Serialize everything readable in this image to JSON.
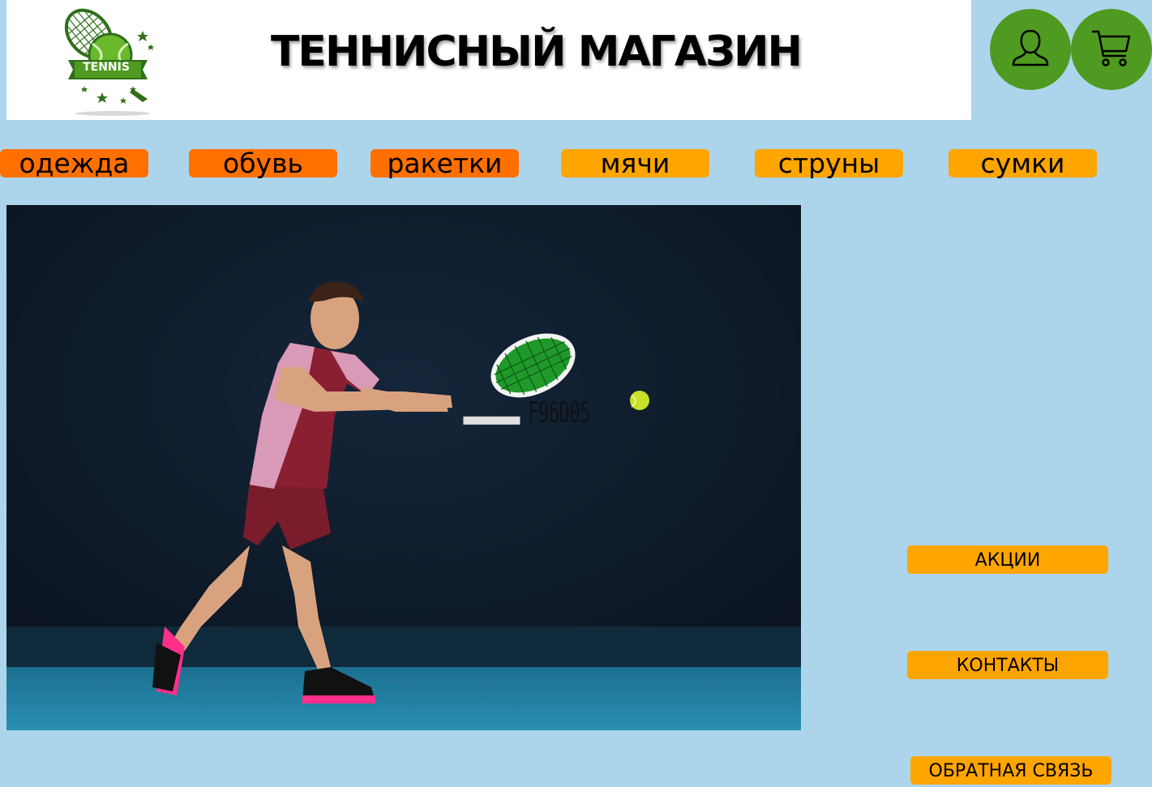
{
  "header": {
    "title": "ТЕННИСНЫЙ МАГАЗИН",
    "logo_text": "TENNIS"
  },
  "actions": {
    "account_icon": "user-icon",
    "cart_icon": "shopping-cart-icon"
  },
  "nav": {
    "items": [
      {
        "label": "одежда",
        "color": "#ff7000"
      },
      {
        "label": "обувь",
        "color": "#ff7000"
      },
      {
        "label": "ракетки",
        "color": "#ff7000"
      },
      {
        "label": "мячи",
        "color": "#ffa500"
      },
      {
        "label": "струны",
        "color": "#ffa500"
      },
      {
        "label": "сумки",
        "color": "#ffa500"
      }
    ]
  },
  "hero": {
    "watermark_text": "F96D05"
  },
  "side": {
    "promo": "АКЦИИ",
    "contacts": "КОНТАКТЫ",
    "feedback": "ОБРАТНАЯ СВЯЗЬ"
  },
  "colors": {
    "page_bg": "#acd5ec",
    "brand_green": "#4f9a20",
    "nav_dark_orange": "#ff7000",
    "nav_light_orange": "#ffa500"
  }
}
